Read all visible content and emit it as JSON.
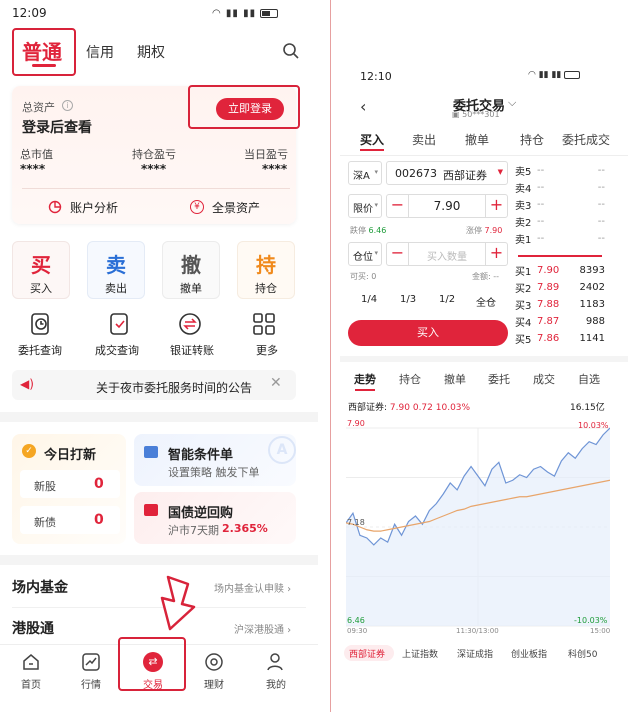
{
  "left": {
    "status_time": "12:09",
    "top_tabs": [
      "普通",
      "信用",
      "期权"
    ],
    "account": {
      "label": "总资产",
      "login_prompt": "登录后查看",
      "login_button": "立即登录",
      "metrics": [
        {
          "label": "总市值",
          "value": "****"
        },
        {
          "label": "持仓盈亏",
          "value": "****"
        },
        {
          "label": "当日盈亏",
          "value": "****"
        }
      ],
      "links": [
        "账户分析",
        "全景资产"
      ]
    },
    "trade_buttons": [
      {
        "glyph": "买",
        "label": "买入",
        "color": "#e0243b"
      },
      {
        "glyph": "卖",
        "label": "卖出",
        "color": "#2a6fd6"
      },
      {
        "glyph": "撤",
        "label": "撤单",
        "color": "#555555"
      },
      {
        "glyph": "持",
        "label": "持仓",
        "color": "#f08a1c"
      }
    ],
    "quick_links": [
      {
        "label": "委托查询",
        "icon": "clock-doc-icon"
      },
      {
        "label": "成交查询",
        "icon": "check-doc-icon"
      },
      {
        "label": "银证转账",
        "icon": "transfer-icon"
      },
      {
        "label": "更多",
        "icon": "grid-icon"
      }
    ],
    "notice": "关于夜市委托服务时间的公告",
    "ipo": {
      "title": "今日打新",
      "rows": [
        {
          "label": "新股",
          "value": "0"
        },
        {
          "label": "新债",
          "value": "0"
        }
      ]
    },
    "smart_order": {
      "title": "智能条件单",
      "sub": "设置策略 触发下单"
    },
    "repo": {
      "title": "国债逆回购",
      "sub": "沪市7天期",
      "rate": "2.365%"
    },
    "sections": [
      {
        "title": "场内基金",
        "link": "场内基金认申赎"
      },
      {
        "title": "港股通",
        "link": "沪深港股通"
      }
    ],
    "bottom_nav": [
      {
        "label": "首页",
        "icon": "home-icon"
      },
      {
        "label": "行情",
        "icon": "chart-icon"
      },
      {
        "label": "交易",
        "icon": "trade-icon"
      },
      {
        "label": "理财",
        "icon": "finance-icon"
      },
      {
        "label": "我的",
        "icon": "user-icon"
      }
    ]
  },
  "right": {
    "status_time": "12:10",
    "title": "委托交易",
    "account_masked": "50***301",
    "tabs": [
      "买入",
      "卖出",
      "撤单",
      "持仓",
      "委托成交"
    ],
    "market": "深A",
    "stock_code": "002673",
    "stock_name": "西部证券",
    "price_type": "限价",
    "price": "7.90",
    "limit_down_label": "跌停",
    "limit_down": "6.46",
    "limit_up_label": "涨停",
    "limit_up": "7.90",
    "qty_type": "仓位",
    "qty_placeholder": "买入数量",
    "available_label": "可买:",
    "available": "0",
    "amount_label": "金额:",
    "amount": "--",
    "fractions": [
      "1/4",
      "1/3",
      "1/2",
      "全仓"
    ],
    "buy_button": "买入",
    "asks": [
      {
        "label": "卖5",
        "price": "--",
        "vol": "--"
      },
      {
        "label": "卖4",
        "price": "--",
        "vol": "--"
      },
      {
        "label": "卖3",
        "price": "--",
        "vol": "--"
      },
      {
        "label": "卖2",
        "price": "--",
        "vol": "--"
      },
      {
        "label": "卖1",
        "price": "--",
        "vol": "--"
      }
    ],
    "bids": [
      {
        "label": "买1",
        "price": "7.90",
        "vol": "8393"
      },
      {
        "label": "买2",
        "price": "7.89",
        "vol": "2402"
      },
      {
        "label": "买3",
        "price": "7.88",
        "vol": "1183"
      },
      {
        "label": "买4",
        "price": "7.87",
        "vol": "988"
      },
      {
        "label": "买5",
        "price": "7.86",
        "vol": "1141"
      }
    ],
    "bottom_tabs": [
      "走势",
      "持仓",
      "撤单",
      "委托",
      "成交",
      "自选"
    ],
    "quote": {
      "name": "西部证券:",
      "price": "7.90",
      "change": "0.72",
      "pct": "10.03%",
      "amount": "16.15亿"
    },
    "chart_labels": {
      "y_top": "7.90",
      "y_mid": "7.18",
      "y_bottom": "6.46",
      "pct_top": "10.03%",
      "pct_bottom": "-10.03%",
      "x_start": "09:30",
      "x_mid": "11:30/13:00",
      "x_end": "15:00"
    },
    "index_tabs": [
      "西部证券",
      "上证指数",
      "深证成指",
      "创业板指",
      "科创50"
    ]
  },
  "chart_data": {
    "type": "line",
    "title": "",
    "xlabel": "",
    "ylabel": "",
    "x": [
      "09:30",
      "11:30/13:00",
      "15:00"
    ],
    "ylim": [
      6.46,
      7.9
    ],
    "series": [
      {
        "values": [
          7.21,
          7.28,
          7.12,
          7.1,
          7.05,
          7.1,
          7.07,
          7.2,
          7.12,
          7.22,
          7.26,
          7.2,
          7.3,
          7.35,
          7.42,
          7.5,
          7.45,
          7.55,
          7.62,
          7.55,
          7.48,
          7.6,
          7.65,
          7.5,
          7.52,
          7.56,
          7.54,
          7.6,
          7.62,
          7.58,
          7.55,
          7.66,
          7.72,
          7.68,
          7.75,
          7.8,
          7.78,
          7.85,
          7.9
        ]
      },
      {
        "values": [
          7.21,
          7.2,
          7.18,
          7.16,
          7.15,
          7.15,
          7.16,
          7.17,
          7.18,
          7.19,
          7.2,
          7.21,
          7.22,
          7.24,
          7.26,
          7.28,
          7.3,
          7.31,
          7.33,
          7.34,
          7.35,
          7.36,
          7.37,
          7.38,
          7.39,
          7.4,
          7.4,
          7.41,
          7.42,
          7.43,
          7.44,
          7.45,
          7.46,
          7.47,
          7.48,
          7.49,
          7.5,
          7.51,
          7.52
        ]
      }
    ]
  }
}
